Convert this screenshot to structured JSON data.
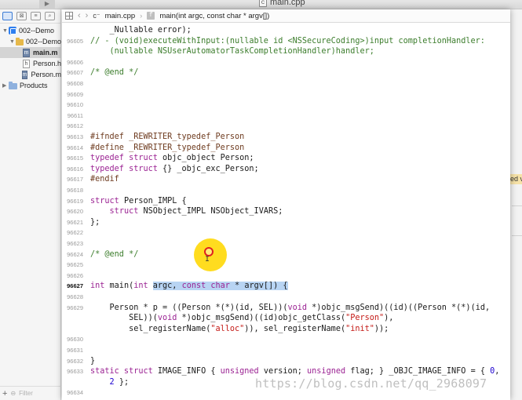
{
  "window": {
    "title": "main.cpp"
  },
  "navigator": {
    "tree": [
      {
        "label": "002--Demo",
        "kind": "project",
        "indent": 0,
        "expanded": true,
        "selected": false
      },
      {
        "label": "002--Demo",
        "kind": "folder",
        "indent": 1,
        "expanded": true,
        "selected": false
      },
      {
        "label": "main.m",
        "kind": "file-m",
        "indent": 2,
        "selected": true
      },
      {
        "label": "Person.h",
        "kind": "file-h",
        "indent": 2,
        "selected": false
      },
      {
        "label": "Person.m",
        "kind": "file-m",
        "indent": 2,
        "selected": false
      },
      {
        "label": "Products",
        "kind": "folder-blue",
        "indent": 0,
        "expanded": false,
        "selected": false
      }
    ],
    "filter_placeholder": "Filter"
  },
  "jumpbar": {
    "file": "main.cpp",
    "symbol": "main(int argc, const char * argv[])"
  },
  "editor": {
    "current_line": "96627",
    "lines": [
      {
        "n": "",
        "segs": [
          [
            "pl",
            "    _Nullable error);"
          ]
        ]
      },
      {
        "n": "96605",
        "segs": [
          [
            "cm",
            "// - (void)executeWithInput:(nullable id <NSSecureCoding>)input completionHandler:"
          ]
        ]
      },
      {
        "n": "",
        "segs": [
          [
            "cm",
            "    (nullable NSUserAutomatorTaskCompletionHandler)handler;"
          ]
        ]
      },
      {
        "n": "96606",
        "segs": []
      },
      {
        "n": "96607",
        "segs": [
          [
            "cm",
            "/* @end */"
          ]
        ]
      },
      {
        "n": "96608",
        "segs": []
      },
      {
        "n": "96609",
        "segs": []
      },
      {
        "n": "96610",
        "segs": []
      },
      {
        "n": "96611",
        "segs": []
      },
      {
        "n": "96612",
        "segs": []
      },
      {
        "n": "96613",
        "segs": [
          [
            "pp",
            "#ifndef _REWRITER_typedef_Person"
          ]
        ]
      },
      {
        "n": "96614",
        "segs": [
          [
            "pp",
            "#define _REWRITER_typedef_Person"
          ]
        ]
      },
      {
        "n": "96615",
        "segs": [
          [
            "kw",
            "typedef struct"
          ],
          [
            "pl",
            " objc_object Person;"
          ]
        ]
      },
      {
        "n": "96616",
        "segs": [
          [
            "kw",
            "typedef struct"
          ],
          [
            "pl",
            " {} _objc_exc_Person;"
          ]
        ]
      },
      {
        "n": "96617",
        "segs": [
          [
            "pp",
            "#endif"
          ]
        ]
      },
      {
        "n": "96618",
        "segs": []
      },
      {
        "n": "96619",
        "segs": [
          [
            "kw",
            "struct"
          ],
          [
            "pl",
            " Person_IMPL {"
          ]
        ]
      },
      {
        "n": "96620",
        "segs": [
          [
            "pl",
            "    "
          ],
          [
            "kw",
            "struct"
          ],
          [
            "pl",
            " NSObject_IMPL NSObject_IVARS;"
          ]
        ]
      },
      {
        "n": "96621",
        "segs": [
          [
            "pl",
            "};"
          ]
        ]
      },
      {
        "n": "96622",
        "segs": []
      },
      {
        "n": "96623",
        "segs": []
      },
      {
        "n": "96624",
        "segs": [
          [
            "cm",
            "/* @end */"
          ]
        ]
      },
      {
        "n": "96625",
        "segs": []
      },
      {
        "n": "96626",
        "segs": []
      },
      {
        "n": "96627",
        "segs": [
          [
            "kw",
            "int"
          ],
          [
            "pl",
            " main("
          ],
          [
            "kw",
            "int"
          ],
          [
            "pl",
            " "
          ],
          [
            "hl",
            "argc, "
          ],
          [
            "hlkw",
            "const char"
          ],
          [
            "hl",
            " * argv[]) {"
          ]
        ]
      },
      {
        "n": "96628",
        "segs": []
      },
      {
        "n": "96629",
        "segs": [
          [
            "pl",
            "    Person * p = ((Person *(*)(id, SEL))("
          ],
          [
            "kw",
            "void"
          ],
          [
            "pl",
            " *)objc_msgSend)((id)((Person *(*)(id,"
          ]
        ]
      },
      {
        "n": "",
        "segs": [
          [
            "pl",
            "        SEL))("
          ],
          [
            "kw",
            "void"
          ],
          [
            "pl",
            " *)objc_msgSend)((id)objc_getClass("
          ],
          [
            "st",
            "\"Person\""
          ],
          [
            "pl",
            "),"
          ]
        ]
      },
      {
        "n": "",
        "segs": [
          [
            "pl",
            "        sel_registerName("
          ],
          [
            "st",
            "\"alloc\""
          ],
          [
            "pl",
            ")), sel_registerName("
          ],
          [
            "st",
            "\"init\""
          ],
          [
            "pl",
            "));"
          ]
        ]
      },
      {
        "n": "96630",
        "segs": []
      },
      {
        "n": "96631",
        "segs": []
      },
      {
        "n": "96632",
        "segs": [
          [
            "pl",
            "}"
          ]
        ]
      },
      {
        "n": "96633",
        "segs": [
          [
            "kw",
            "static struct"
          ],
          [
            "pl",
            " IMAGE_INFO { "
          ],
          [
            "kw",
            "unsigned"
          ],
          [
            "pl",
            " version; "
          ],
          [
            "kw",
            "unsigned"
          ],
          [
            "pl",
            " flag; } _OBJC_IMAGE_INFO = { "
          ],
          [
            "nu",
            "0"
          ],
          [
            "pl",
            ","
          ]
        ]
      },
      {
        "n": "",
        "segs": [
          [
            "pl",
            "    "
          ],
          [
            "nu",
            "2"
          ],
          [
            "pl",
            " };"
          ]
        ]
      },
      {
        "n": "96634",
        "segs": []
      }
    ]
  },
  "right_window": {
    "badge_text": "ed v"
  },
  "watermark": "https://blog.csdn.net/qq_2968097"
}
